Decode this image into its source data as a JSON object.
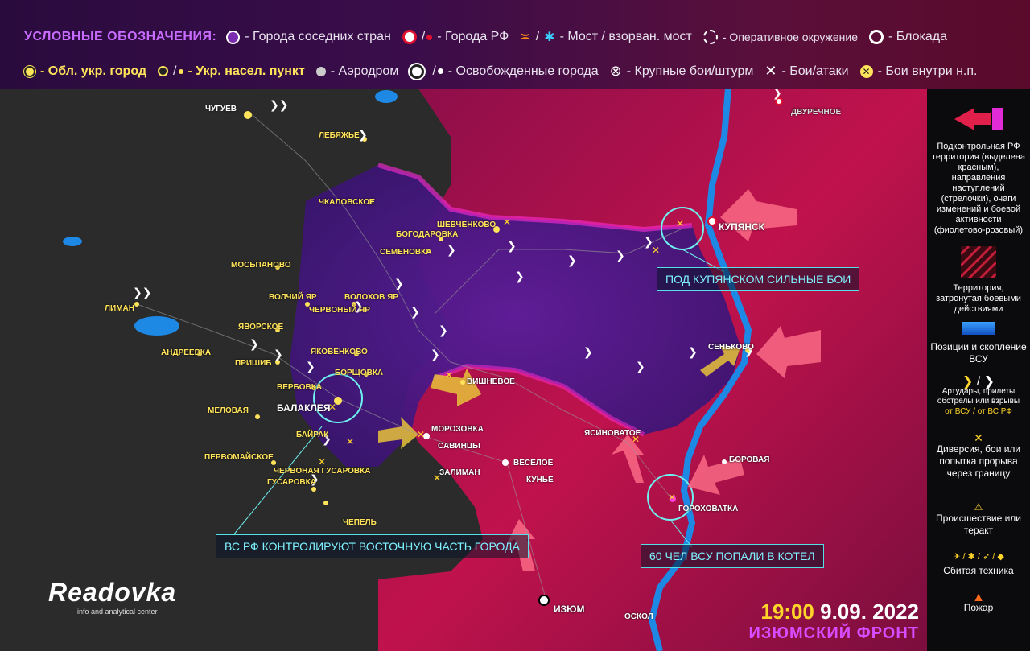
{
  "legend": {
    "title": "УСЛОВНЫЕ ОБОЗНАЧЕНИЯ:",
    "row1": [
      {
        "icon": "neighbor-city-dot",
        "label": "- Города соседних стран"
      },
      {
        "icon": "rf-city-dot",
        "label": "- Города РФ"
      },
      {
        "icon": "bridge-icon",
        "label": "- Мост / взорван. мост"
      },
      {
        "icon": "encirclement-icon",
        "label": "- Оперативное окружение"
      },
      {
        "icon": "blockade-icon",
        "label": "- Блокада"
      }
    ],
    "row2": [
      {
        "icon": "ukr-oblast-city-dot",
        "label": "- Обл. укр. город"
      },
      {
        "icon": "ukr-settlement-dot",
        "label": "- Укр. насел. пункт"
      },
      {
        "icon": "airfield-icon",
        "label": "- Аэродром"
      },
      {
        "icon": "liberated-city-dot",
        "label": "- Освобожденные города"
      },
      {
        "icon": "major-battle-icon",
        "label": "- Крупные бои/штурм"
      },
      {
        "icon": "battle-icon",
        "label": "- Бои/атаки"
      },
      {
        "icon": "settlement-battle-icon",
        "label": "- Бои внутри н.п."
      }
    ],
    "bridge_sep": "/",
    "dot_sep": "/"
  },
  "sidebar": {
    "rf_territory": "Подконтрольная РФ территория (выделена красным), направления наступлений (стрелочки), очаги изменений и боевой активности (фиолетово-розовый)",
    "combat_zone": "Территория, затронутая боевыми действиями",
    "afu_positions": "Позиции и скопление ВСУ",
    "shelling_title": "Артудары, прилеты обстрелы или взрывы",
    "shelling_by": "от ВСУ / от ВС РФ",
    "sabotage": "Диверсия, бои или попытка прорыва через границу",
    "incident": "Происшествие или теракт",
    "downed": "Сбитая техника",
    "fire": "Пожар"
  },
  "places": {
    "chuguev": "ЧУГУЕВ",
    "lebyazhe": "ЛЕБЯЖЬЕ",
    "dvurechnoe": "ДВУРЕЧНОЕ",
    "chkalovskoe": "ЧКАЛОВСКОЕ",
    "shevchenkovo": "ШЕВЧЕНКОВО",
    "bogodarovka": "БОГОДАРОВКА",
    "semenovka": "СЕМЕНОВКА",
    "kupyansk": "КУПЯНСК",
    "mospanovo": "МОСЬПАНОВО",
    "liman": "ЛИМАН",
    "volchiy_yar": "ВОЛЧИЙ ЯР",
    "volokhov_yar": "ВОЛОХОВ ЯР",
    "chervonyi_yar": "ЧЕРВОНЫЙ ЯР",
    "yavorskoe": "ЯВОРСКОЕ",
    "andreevka": "АНДРЕЕВКА",
    "prishib": "ПРИШИБ",
    "yakovenkovo": "ЯКОВЕНКОВО",
    "borshchovka": "БОРЩОВКА",
    "verbovka": "ВЕРБОВКА",
    "balakleya": "БАЛАКЛЕЯ",
    "vishnevoe": "ВИШНЕВОЕ",
    "senkovo": "СЕНЬКОВО",
    "melovaya": "МЕЛОВАЯ",
    "morozovka": "МОРОЗОВКА",
    "savintsy": "САВИНЦЫ",
    "bairak": "БАЙРАК",
    "pervomayskoe": "ПЕРВОМАЙСКОЕ",
    "chervonaya_gusarovka": "ЧЕРВОНАЯ ГУСАРОВКА",
    "gusarovka": "ГУСАРОВКА",
    "zaliman": "ЗАЛИМАН",
    "veseloe": "ВЕСЕЛОЕ",
    "kune": "КУНЬЕ",
    "yasinovatoe": "ЯСИНОВАТОЕ",
    "borovaya": "БОРОВАЯ",
    "gorokhovatka": "ГОРОХОВАТКА",
    "chepel": "ЧЕПЕЛЬ",
    "izyum": "ИЗЮМ",
    "oskol": "ОСКОЛ"
  },
  "callouts": {
    "kupyansk_fighting": "ПОД КУПЯНСКОМ СИЛЬНЫЕ БОИ",
    "balakleya_control": "ВС РФ КОНТРОЛИРУЮТ ВОСТОЧНУЮ ЧАСТЬ ГОРОДА",
    "cauldron": "60 ЧЕЛ ВСУ ПОПАЛИ В КОТЕЛ"
  },
  "brand": {
    "name": "Readovka",
    "sub": "info and analytical center"
  },
  "stamp": {
    "time": "19:00",
    "date": "9.09. 2022",
    "front": "ИЗЮМСКИЙ ФРОНТ"
  },
  "colors": {
    "rf_territory": "#c4124f",
    "contested": "#6a1aa8",
    "afu_water": "#1e88e5",
    "callout_border": "#55e0e8",
    "accent_yellow": "#ffd52a"
  }
}
